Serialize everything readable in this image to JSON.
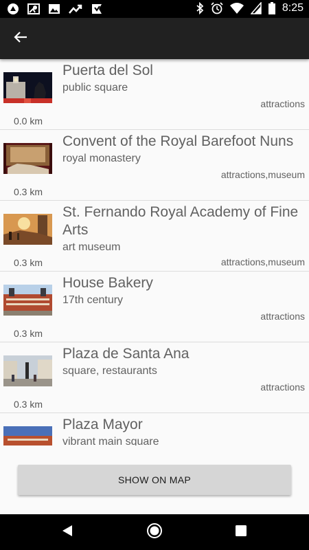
{
  "status_bar": {
    "time": "8:25",
    "left_icons": [
      "app-notification-icon",
      "map-notification-icon",
      "photo-notification-icon",
      "trending-notification-icon",
      "bookmark-notification-icon"
    ],
    "right_icons": [
      "bluetooth-icon",
      "alarm-icon",
      "wifi-icon",
      "cell-signal-icon",
      "battery-icon"
    ]
  },
  "app_bar": {
    "back_icon": "arrow-back-icon"
  },
  "places": [
    {
      "name": "Puerta del Sol",
      "subtitle": "public square",
      "categories": "attractions",
      "distance": "0.0 km",
      "thumb": "puerta-del-sol-thumbnail"
    },
    {
      "name": "Convent of the Royal Barefoot Nuns",
      "subtitle": "royal monastery",
      "categories": "attractions,museum",
      "distance": "0.3 km",
      "thumb": "convent-thumbnail"
    },
    {
      "name": "St. Fernando Royal Academy of Fine Arts",
      "subtitle": "art museum",
      "categories": "attractions,museum",
      "distance": "0.3 km",
      "thumb": "academy-thumbnail"
    },
    {
      "name": "House Bakery",
      "subtitle": "17th century",
      "categories": "attractions",
      "distance": "0.3 km",
      "thumb": "house-bakery-thumbnail"
    },
    {
      "name": "Plaza de Santa Ana",
      "subtitle": "square, restaurants",
      "categories": "attractions",
      "distance": "0.3 km",
      "thumb": "plaza-santa-ana-thumbnail"
    },
    {
      "name": "Plaza Mayor",
      "subtitle": "vibrant main square",
      "categories": "",
      "distance": "",
      "thumb": "plaza-mayor-thumbnail"
    }
  ],
  "actions": {
    "show_on_map": "SHOW ON MAP"
  },
  "nav_bar": {
    "buttons": [
      "back-triangle-icon",
      "home-circle-icon",
      "recents-square-icon"
    ]
  },
  "colors": {
    "app_bar": "#212121",
    "list_bg": "#fafafa",
    "text": "#616161",
    "button": "#d6d6d6"
  }
}
